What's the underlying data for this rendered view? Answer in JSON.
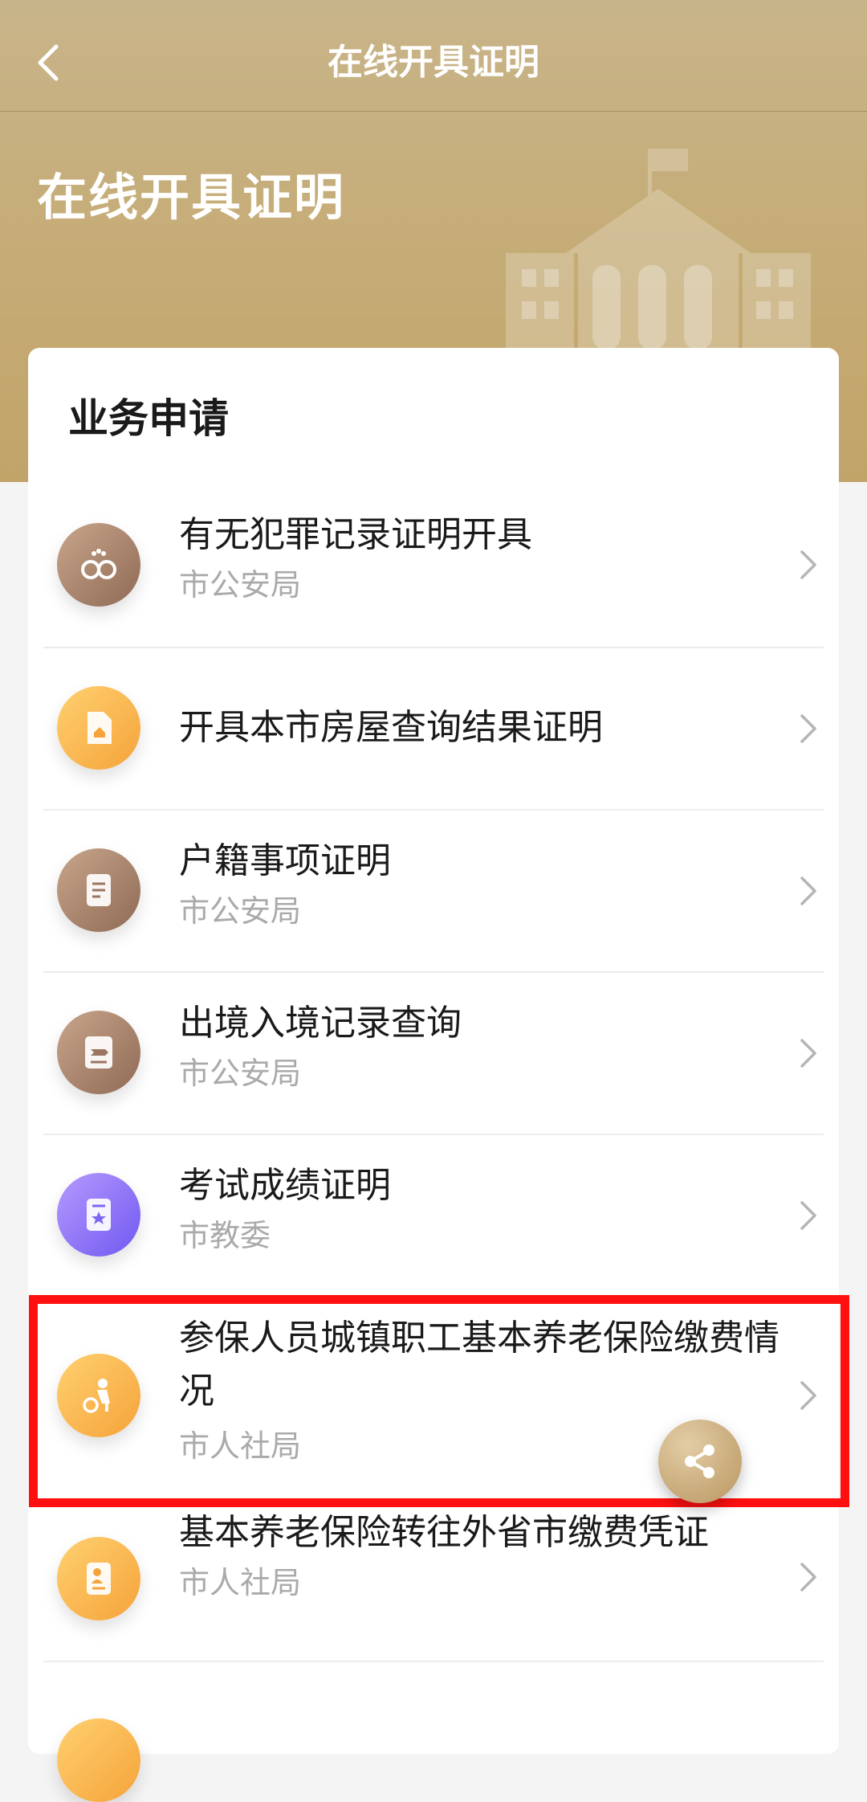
{
  "navbar": {
    "title": "在线开具证明"
  },
  "hero": {
    "title": "在线开具证明"
  },
  "section": {
    "title": "业务申请"
  },
  "items": [
    {
      "title": "有无犯罪记录证明开具",
      "subtitle": "市公安局",
      "icon": "handcuffs-icon"
    },
    {
      "title": "开具本市房屋查询结果证明",
      "subtitle": "",
      "icon": "house-document-icon"
    },
    {
      "title": "户籍事项证明",
      "subtitle": "市公安局",
      "icon": "document-lines-icon"
    },
    {
      "title": "出境入境记录查询",
      "subtitle": "市公安局",
      "icon": "airplane-icon"
    },
    {
      "title": "考试成绩证明",
      "subtitle": "市教委",
      "icon": "star-certificate-icon"
    },
    {
      "title": "参保人员城镇职工基本养老保险缴费情况",
      "subtitle": "市人社局",
      "icon": "elderly-wheelchair-icon"
    },
    {
      "title": "基本养老保险转往外省市缴费凭证",
      "subtitle": "市人社局",
      "icon": "person-document-icon"
    }
  ],
  "colors": {
    "hero": "#c6ad79",
    "highlight": "#ff1010",
    "subtitle": "#aaaaaa"
  }
}
